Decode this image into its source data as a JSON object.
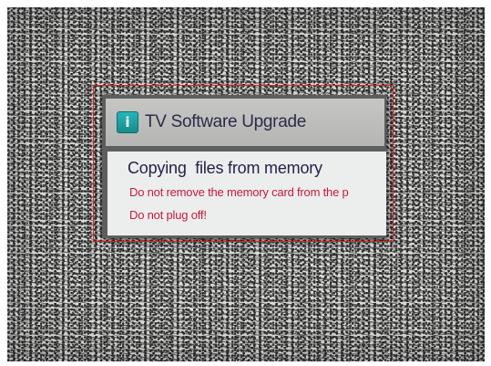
{
  "dialog": {
    "icon": "info-icon",
    "icon_glyph": "i",
    "title": "TV Software Upgrade",
    "heading": "Copying  files from memory",
    "lines": [
      "Do not remove the memory card from the p",
      "Do not plug off!"
    ]
  },
  "colors": {
    "warning_text": "#c8193a",
    "highlight_box": "#e0201f"
  }
}
